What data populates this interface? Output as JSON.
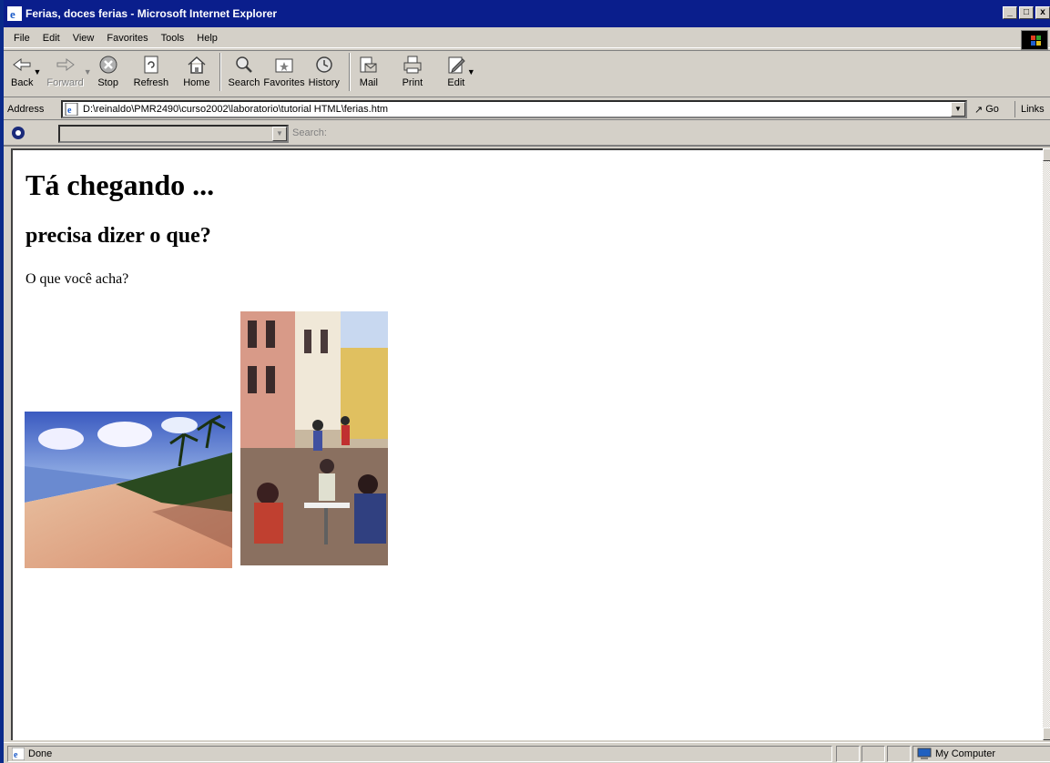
{
  "window": {
    "title": "Ferias, doces ferias - Microsoft Internet Explorer",
    "minimize": "_",
    "maximize": "□",
    "close": "x"
  },
  "menu": [
    "File",
    "Edit",
    "View",
    "Favorites",
    "Tools",
    "Help"
  ],
  "toolbar": {
    "back": "Back",
    "forward": "Forward",
    "stop": "Stop",
    "refresh": "Refresh",
    "home": "Home",
    "search": "Search",
    "favorites": "Favorites",
    "history": "History",
    "mail": "Mail",
    "print": "Print",
    "edit": "Edit"
  },
  "address": {
    "label": "Address",
    "value": "D:\\reinaldo\\PMR2490\\curso2002\\laboratorio\\tutorial HTML\\ferias.htm",
    "go": "Go",
    "links": "Links"
  },
  "searchbar": {
    "label": "Search:"
  },
  "page": {
    "heading1": "Tá chegando ...",
    "heading2": "precisa dizer o que?",
    "paragraph": "O que você acha?"
  },
  "status": {
    "text": "Done",
    "zone": "My Computer"
  },
  "colors": {
    "titlebar": "#0a1e8c",
    "chrome": "#d4d0c8",
    "desktop": "#0a2a8a"
  },
  "icons": [
    "ie-icon",
    "back-icon",
    "forward-icon",
    "stop-icon",
    "refresh-icon",
    "home-icon",
    "search-icon",
    "favorites-icon",
    "history-icon",
    "mail-icon",
    "print-icon",
    "edit-icon",
    "page-icon",
    "go-icon",
    "search-engine-icon",
    "done-icon",
    "computer-icon"
  ]
}
